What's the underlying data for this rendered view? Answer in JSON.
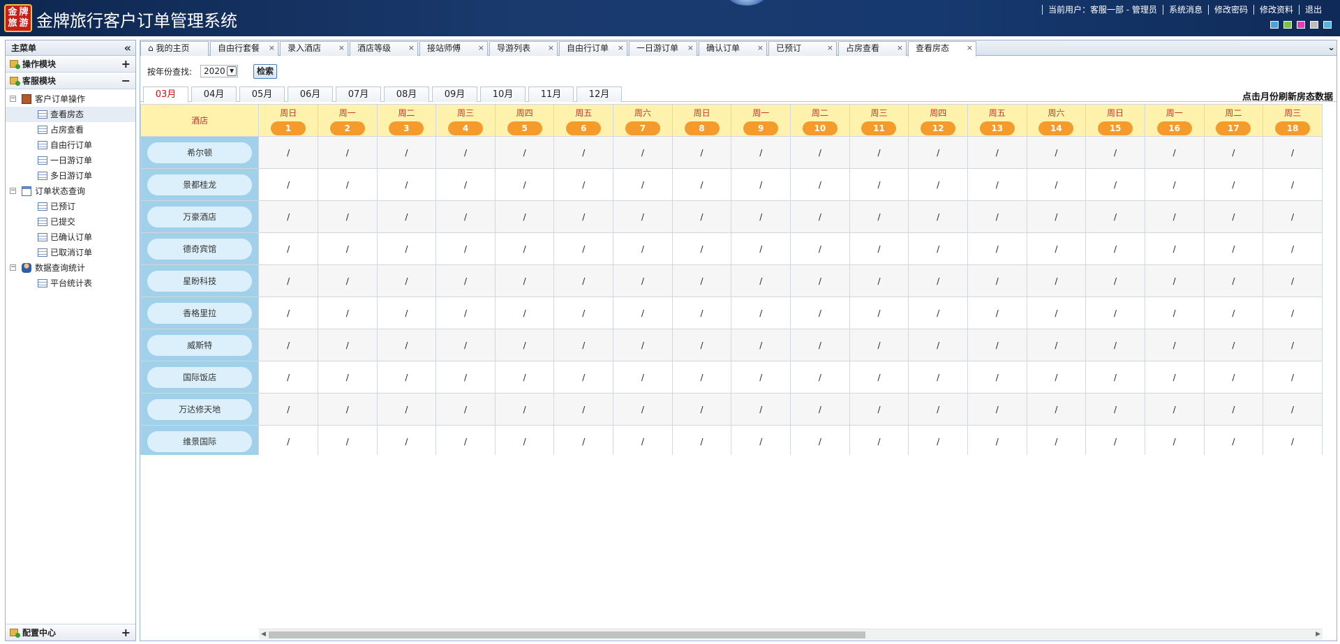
{
  "header": {
    "logo_text": [
      "金",
      "牌",
      "旅",
      "游"
    ],
    "title": "金牌旅行客户订单管理系统",
    "links": [
      "当前用户：客服一部 - 管理员",
      "系统消息",
      "修改密码",
      "修改资料",
      "退出"
    ],
    "skins": [
      "#4aa3df",
      "#7dc242",
      "#e23fb7",
      "#bdbdbd",
      "#4fb7e8"
    ]
  },
  "sidebar": {
    "title": "主菜单",
    "collapse_icon": "«",
    "sections": [
      {
        "label": "操作模块",
        "toggle": "+"
      },
      {
        "label": "客服模块",
        "toggle": "−"
      }
    ],
    "tree": [
      {
        "label": "客户订单操作",
        "level": 1,
        "icon": "book",
        "exp": "−"
      },
      {
        "label": "查看房态",
        "level": 2,
        "selected": true
      },
      {
        "label": "占房查看",
        "level": 2
      },
      {
        "label": "自由行订单",
        "level": 2
      },
      {
        "label": "一日游订单",
        "level": 2
      },
      {
        "label": "多日游订单",
        "level": 2
      },
      {
        "label": "订单状态查询",
        "level": 1,
        "icon": "win",
        "exp": "−"
      },
      {
        "label": "已预订",
        "level": 2
      },
      {
        "label": "已提交",
        "level": 2
      },
      {
        "label": "已确认订单",
        "level": 2
      },
      {
        "label": "已取消订单",
        "level": 2
      },
      {
        "label": "数据查询统计",
        "level": 1,
        "icon": "user",
        "exp": "−"
      },
      {
        "label": "平台统计表",
        "level": 2
      }
    ],
    "config": {
      "label": "配置中心",
      "toggle": "+"
    }
  },
  "tabs": [
    {
      "label": "我的主页",
      "home": true
    },
    {
      "label": "自由行套餐"
    },
    {
      "label": "录入酒店"
    },
    {
      "label": "酒店等级"
    },
    {
      "label": "接站师傅"
    },
    {
      "label": "导游列表"
    },
    {
      "label": "自由行订单"
    },
    {
      "label": "一日游订单"
    },
    {
      "label": "确认订单"
    },
    {
      "label": "已预订"
    },
    {
      "label": "占房查看"
    },
    {
      "label": "查看房态",
      "active": true
    }
  ],
  "search": {
    "label": "按年份查找:",
    "year": "2020",
    "button": "检索"
  },
  "months": [
    "03月",
    "04月",
    "05月",
    "06月",
    "07月",
    "08月",
    "09月",
    "10月",
    "11月",
    "12月"
  ],
  "active_month": "03月",
  "refresh_note": "点击月份刷新房态数据",
  "grid": {
    "hotel_header": "酒店",
    "days": [
      {
        "week": "周日",
        "day": "1"
      },
      {
        "week": "周一",
        "day": "2"
      },
      {
        "week": "周二",
        "day": "3"
      },
      {
        "week": "周三",
        "day": "4"
      },
      {
        "week": "周四",
        "day": "5"
      },
      {
        "week": "周五",
        "day": "6"
      },
      {
        "week": "周六",
        "day": "7"
      },
      {
        "week": "周日",
        "day": "8"
      },
      {
        "week": "周一",
        "day": "9"
      },
      {
        "week": "周二",
        "day": "10"
      },
      {
        "week": "周三",
        "day": "11"
      },
      {
        "week": "周四",
        "day": "12"
      },
      {
        "week": "周五",
        "day": "13"
      },
      {
        "week": "周六",
        "day": "14"
      },
      {
        "week": "周日",
        "day": "15"
      },
      {
        "week": "周一",
        "day": "16"
      },
      {
        "week": "周二",
        "day": "17"
      },
      {
        "week": "周三",
        "day": "18"
      }
    ],
    "hotels": [
      "希尔顿",
      "景都桂龙",
      "万豪酒店",
      "德奇宾馆",
      "星盼科技",
      "香格里拉",
      "威斯特",
      "国际饭店",
      "万达修天地",
      "维景国际"
    ],
    "cell_value": "/"
  }
}
